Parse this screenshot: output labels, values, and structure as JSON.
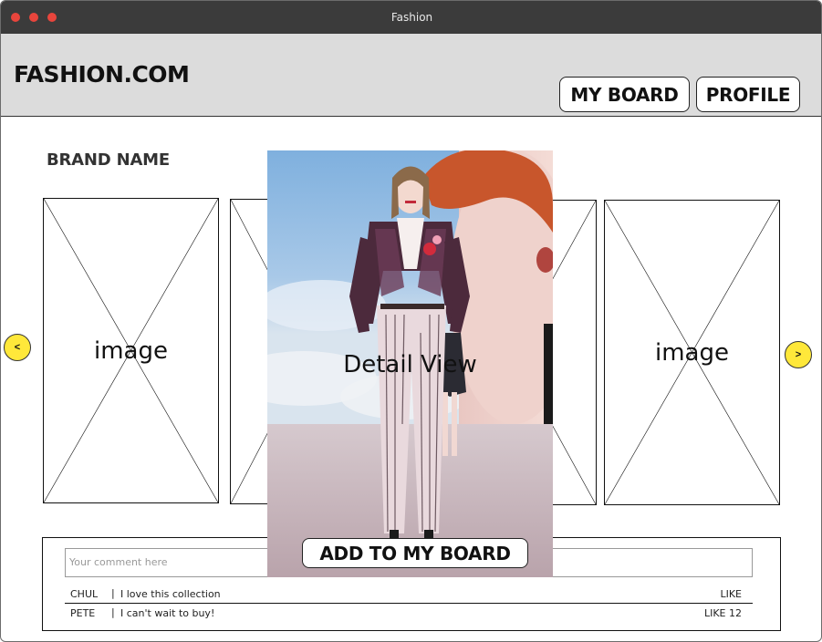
{
  "window": {
    "title": "Fashion"
  },
  "header": {
    "logo": "FASHION.COM",
    "buttons": {
      "my_board": "MY BOARD",
      "profile": "PROFILE"
    }
  },
  "brand": {
    "name": "BRAND NAME"
  },
  "carousel": {
    "image_label": "image",
    "prev_label": "<",
    "next_label": ">"
  },
  "detail": {
    "label": "Detail View",
    "add_button": "ADD TO MY BOARD"
  },
  "comments": {
    "placeholder": "Your comment here",
    "items": [
      {
        "user": "CHUL",
        "text": "I love this collection",
        "like": "LIKE"
      },
      {
        "user": "PETE",
        "text": "I can't wait to buy!",
        "like": "LIKE 12"
      }
    ]
  },
  "colors": {
    "arrow_fill": "#ffe83a",
    "header_bg": "#dcdcdc",
    "titlebar_bg": "#3b3b3b",
    "close_dot": "#e8453c"
  }
}
